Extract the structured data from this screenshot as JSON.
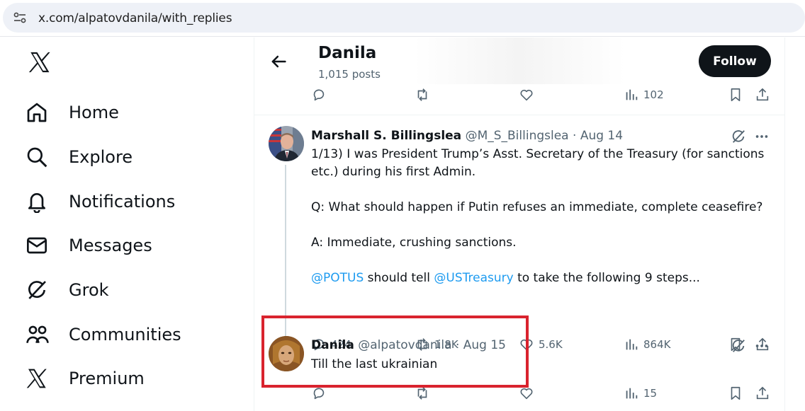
{
  "browser": {
    "url": "x.com/alpatovdanila/with_replies"
  },
  "sidebar": {
    "items": [
      {
        "label": "Home",
        "icon": "home-icon"
      },
      {
        "label": "Explore",
        "icon": "search-icon"
      },
      {
        "label": "Notifications",
        "icon": "bell-icon"
      },
      {
        "label": "Messages",
        "icon": "envelope-icon"
      },
      {
        "label": "Grok",
        "icon": "grok-icon"
      },
      {
        "label": "Communities",
        "icon": "people-icon"
      },
      {
        "label": "Premium",
        "icon": "x-logo-icon"
      }
    ]
  },
  "header": {
    "name": "Danila",
    "posts": "1,015 posts",
    "follow_label": "Follow"
  },
  "top_actions": {
    "views": "102"
  },
  "tweet1": {
    "author": "Marshall S. Billingslea",
    "handle": "@M_S_Billingslea",
    "dot": "·",
    "date": "Aug 14",
    "line1": "1/13) I was President Trump’s Asst. Secretary of the Treasury (for sanctions",
    "line2": "etc.) during his first Admin.",
    "line3": "Q: What should happen if Putin refuses an immediate, complete ceasefire?",
    "line4": "A: Immediate, crushing sanctions.",
    "mention1": "@POTUS",
    "mid": " should tell ",
    "mention2": "@USTreasury",
    "tail": " to take the following 9 steps...",
    "replies": "424",
    "reposts": "1.8K",
    "likes": "5.6K",
    "views": "864K"
  },
  "tweet2": {
    "author": "Danila",
    "handle": "@alpatovdanila",
    "dot": "·",
    "date": "Aug 15",
    "text": "Till the last ukrainian",
    "views": "15"
  },
  "colors": {
    "accent": "#1d9bf0",
    "highlight": "#d9232e",
    "text_secondary": "#536471"
  }
}
